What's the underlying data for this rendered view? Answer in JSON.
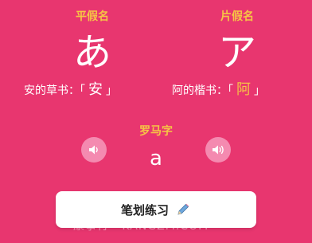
{
  "hiragana": {
    "heading": "平假名",
    "char": "あ",
    "origin_label": "安的草书：",
    "origin_open": "「",
    "origin_char": "安",
    "origin_close": "」"
  },
  "katakana": {
    "heading": "片假名",
    "char": "ア",
    "origin_label": "阿的楷书：",
    "origin_open": "「",
    "origin_char": "阿",
    "origin_close": "」"
  },
  "romaji": {
    "heading": "罗马字",
    "value": "a"
  },
  "practice": {
    "label": "笔划练习"
  },
  "watermark": "康事行 · KANGZM.COM",
  "colors": {
    "background": "#e8366f",
    "accent": "#f6c545",
    "sound_button": "#f48ab0"
  },
  "icons": {
    "sound_left": "speaker-icon",
    "sound_right": "speaker-icon",
    "practice": "pencil-icon"
  }
}
